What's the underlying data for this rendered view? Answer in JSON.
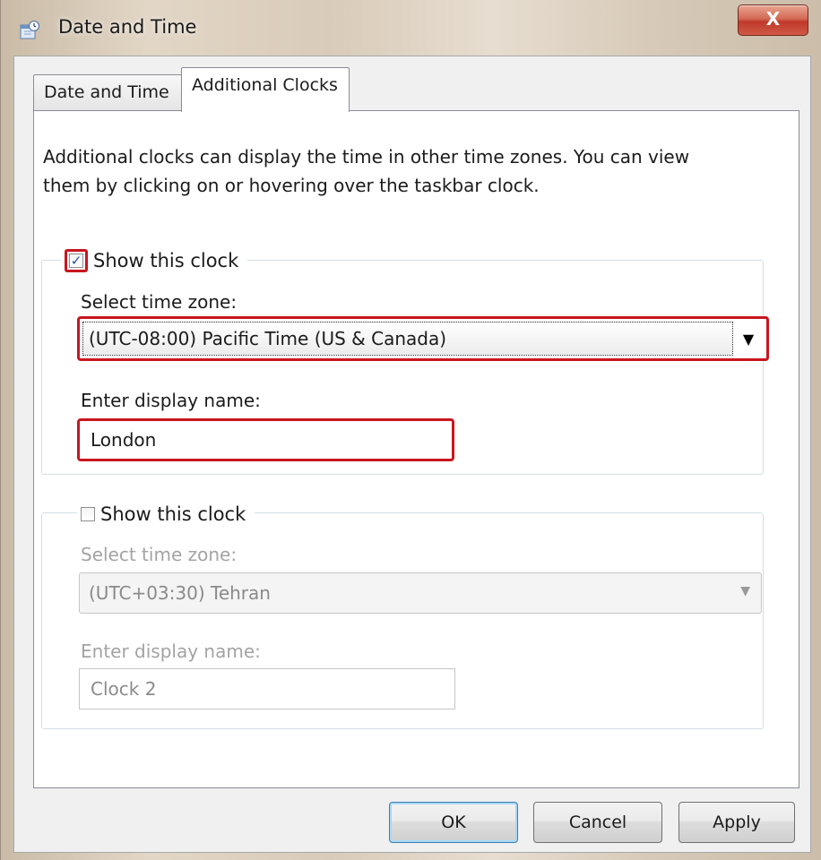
{
  "window": {
    "title": "Date and Time",
    "close_glyph": "X",
    "app_icon": "calendar-clock-icon"
  },
  "tabs": [
    {
      "label": "Date and Time",
      "active": false
    },
    {
      "label": "Additional Clocks",
      "active": true
    }
  ],
  "description": "Additional clocks can display the time in other time zones. You can view them by clicking on or hovering over the taskbar clock.",
  "clock1": {
    "show_label": "Show this clock",
    "checked": true,
    "timezone_label": "Select time zone:",
    "timezone_value": "(UTC-08:00) Pacific Time (US & Canada)",
    "display_name_label": "Enter display name:",
    "display_name_value": "London"
  },
  "clock2": {
    "show_label": "Show this clock",
    "checked": false,
    "timezone_label": "Select time zone:",
    "timezone_value": "(UTC+03:30) Tehran",
    "display_name_label": "Enter display name:",
    "display_name_value": "Clock 2"
  },
  "buttons": {
    "ok": "OK",
    "cancel": "Cancel",
    "apply": "Apply"
  },
  "colors": {
    "highlight": "#c9161e",
    "close_button": "#c0392b",
    "disabled_text": "#a3a3a3"
  }
}
